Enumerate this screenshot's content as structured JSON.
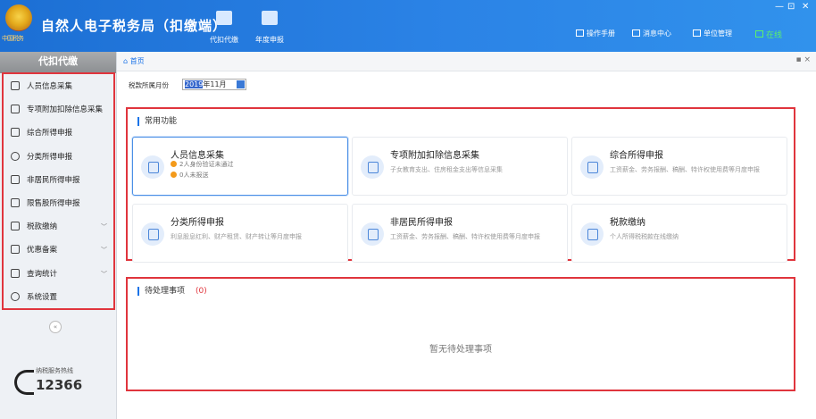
{
  "app": {
    "title": "自然人电子税务局（扣缴端）",
    "emblem_text": "中国税务"
  },
  "header": {
    "tools": [
      {
        "label": "代扣代缴",
        "icon": "withhold-icon"
      },
      {
        "label": "年度申报",
        "icon": "annual-report-icon"
      }
    ],
    "links": [
      {
        "label": "操作手册",
        "icon": "manual-icon"
      },
      {
        "label": "消息中心",
        "icon": "message-icon"
      },
      {
        "label": "单位管理",
        "icon": "company-icon"
      }
    ],
    "online_label": "在线",
    "window_controls": [
      "—",
      "⊡",
      "✕"
    ]
  },
  "sidebar": {
    "title": "代扣代缴",
    "items": [
      {
        "label": "人员信息采集",
        "icon": "person-icon",
        "expandable": false
      },
      {
        "label": "专项附加扣除信息采集",
        "icon": "grid-list-icon",
        "expandable": false
      },
      {
        "label": "综合所得申报",
        "icon": "layers-icon",
        "expandable": false
      },
      {
        "label": "分类所得申报",
        "icon": "pie-icon",
        "expandable": false
      },
      {
        "label": "非居民所得申报",
        "icon": "person-outline-icon",
        "expandable": false
      },
      {
        "label": "限售股所得申报",
        "icon": "bar-icon",
        "expandable": false
      },
      {
        "label": "税款缴纳",
        "icon": "card-icon",
        "expandable": true
      },
      {
        "label": "优惠备案",
        "icon": "doc-icon",
        "expandable": true
      },
      {
        "label": "查询统计",
        "icon": "search-list-icon",
        "expandable": true
      },
      {
        "label": "系统设置",
        "icon": "gear-icon",
        "expandable": false
      }
    ],
    "collapse_label": "«",
    "hotline": {
      "caption": "纳税服务热线",
      "number": "12366"
    }
  },
  "tabs": {
    "home_label": "首页",
    "controls": "▪ ×"
  },
  "period": {
    "label": "税款所属月份",
    "value_year": "2019",
    "value_rest": "年11月"
  },
  "common": {
    "title": "常用功能",
    "cards": [
      {
        "title": "人员信息采集",
        "warn1": "2人身份验证未通过",
        "warn2": "0人未报送"
      },
      {
        "title": "专项附加扣除信息采集",
        "desc": "子女教育支出、住房租金支出等信息采集"
      },
      {
        "title": "综合所得申报",
        "desc": "工资薪金、劳务报酬、稿酬、特许权使用费等月度申报"
      },
      {
        "title": "分类所得申报",
        "desc": "利息股息红利、财产租赁、财产转让等月度申报"
      },
      {
        "title": "非居民所得申报",
        "desc": "工资薪金、劳务报酬、稿酬、特许权使用费等月度申报"
      },
      {
        "title": "税款缴纳",
        "desc": "个人所得税税款在线缴纳"
      }
    ]
  },
  "pending": {
    "title": "待处理事项",
    "count": "(0)",
    "empty_text": "暂无待处理事项"
  },
  "colors": {
    "header": "#2b83e6",
    "accent": "#1a73e8",
    "highlight": "#e0353d",
    "warn": "#f39a1b"
  }
}
